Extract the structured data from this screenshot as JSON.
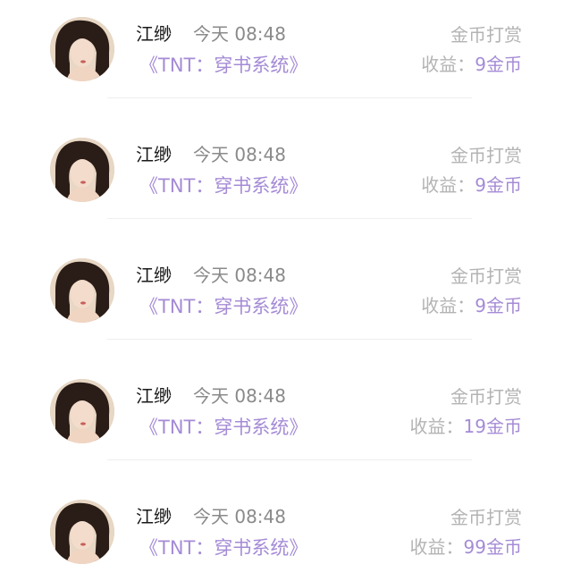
{
  "records": [
    {
      "name": "江缈",
      "time": "今天 08:48",
      "book": "《TNT：穿书系统》",
      "type": "金币打赏",
      "income_label": "收益：",
      "income_amount": "9金币"
    },
    {
      "name": "江缈",
      "time": "今天 08:48",
      "book": "《TNT：穿书系统》",
      "type": "金币打赏",
      "income_label": "收益：",
      "income_amount": "9金币"
    },
    {
      "name": "江缈",
      "time": "今天 08:48",
      "book": "《TNT：穿书系统》",
      "type": "金币打赏",
      "income_label": "收益：",
      "income_amount": "9金币"
    },
    {
      "name": "江缈",
      "time": "今天 08:48",
      "book": "《TNT：穿书系统》",
      "type": "金币打赏",
      "income_label": "收益：",
      "income_amount": "19金币"
    },
    {
      "name": "江缈",
      "time": "今天 08:48",
      "book": "《TNT：穿书系统》",
      "type": "金币打赏",
      "income_label": "收益：",
      "income_amount": "99金币"
    }
  ],
  "colors": {
    "accent": "#a58bd6",
    "name": "#1a1a1a",
    "muted": "#8a8a8a",
    "label": "#b3b3b3",
    "divider": "#eeeeee"
  },
  "icons": {
    "avatar": "user-avatar-photo"
  }
}
